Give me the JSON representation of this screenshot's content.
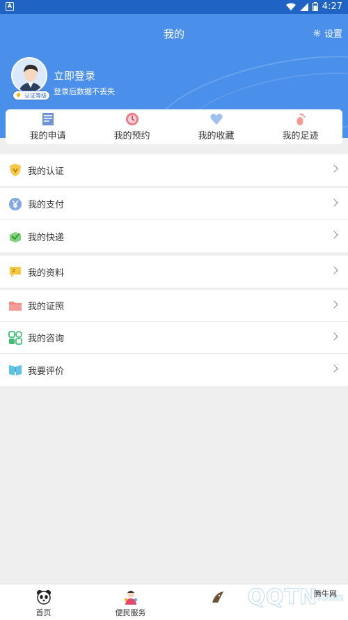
{
  "status_bar": {
    "time": "4:27"
  },
  "header": {
    "title": "我的",
    "settings_label": "设置",
    "badge_text": "认证等级",
    "login_title": "立即登录",
    "login_subtitle": "登录后数据不丢失"
  },
  "quick_actions": [
    {
      "label": "我的申请",
      "icon": "application-icon"
    },
    {
      "label": "我的预约",
      "icon": "clock-icon"
    },
    {
      "label": "我的收藏",
      "icon": "heart-icon"
    },
    {
      "label": "我的足迹",
      "icon": "footprint-icon"
    }
  ],
  "menu_groups": [
    {
      "items": [
        {
          "label": "我的认证",
          "icon": "shield-icon"
        }
      ]
    },
    {
      "items": [
        {
          "label": "我的支付",
          "icon": "yen-icon"
        },
        {
          "label": "我的快递",
          "icon": "package-icon"
        }
      ]
    },
    {
      "items": [
        {
          "label": "我的资料",
          "icon": "document-icon"
        }
      ]
    },
    {
      "items": [
        {
          "label": "我的证照",
          "icon": "folder-icon"
        },
        {
          "label": "我的咨询",
          "icon": "consult-icon"
        },
        {
          "label": "我要评价",
          "icon": "book-icon"
        }
      ]
    }
  ],
  "tab_bar": [
    {
      "label": "首页",
      "icon": "panda-icon"
    },
    {
      "label": "便民服务",
      "icon": "service-icon"
    },
    {
      "label": "",
      "icon": "mascot-icon"
    },
    {
      "label": "",
      "icon": ""
    }
  ],
  "watermark": {
    "text": "QQTN",
    "suffix": ".com",
    "site": "腾牛网"
  }
}
